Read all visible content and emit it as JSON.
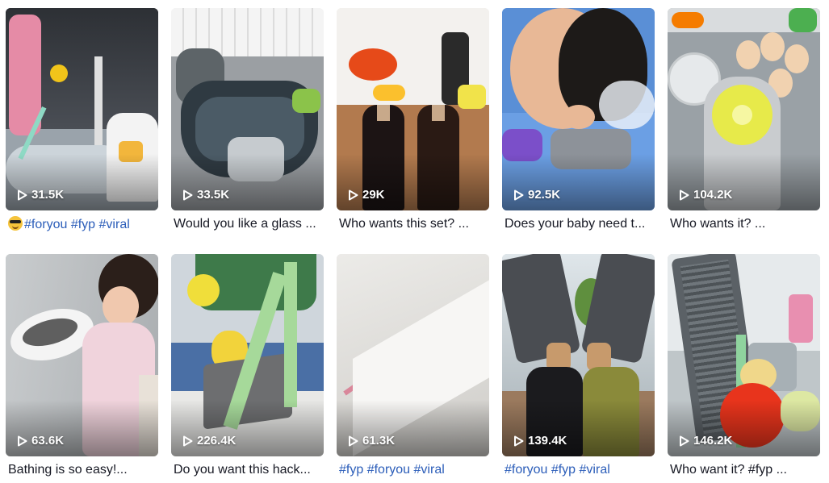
{
  "videos": [
    {
      "views": "31.5K",
      "emoji": "sunglasses-emoji",
      "caption_parts": [
        "#foryou",
        "#fyp",
        "#viral"
      ]
    },
    {
      "views": "33.5K",
      "caption": "Would you like a glass ..."
    },
    {
      "views": "29K",
      "caption": "Who wants this set? ..."
    },
    {
      "views": "92.5K",
      "caption": "Does your baby need t..."
    },
    {
      "views": "104.2K",
      "caption": "Who wants it? ..."
    },
    {
      "views": "63.6K",
      "caption": "Bathing is so easy!..."
    },
    {
      "views": "226.4K",
      "caption": "Do you want this hack..."
    },
    {
      "views": "61.3K",
      "caption_parts": [
        "#fyp",
        "#foryou",
        "#viral"
      ]
    },
    {
      "views": "139.4K",
      "caption_parts": [
        "#foryou",
        "#fyp",
        "#viral"
      ]
    },
    {
      "views": "146.2K",
      "caption": "Who want it? #fyp ..."
    }
  ],
  "colors": {
    "hashtag": "#2b5db9",
    "caption_text": "#161823",
    "view_text": "#ffffff"
  }
}
